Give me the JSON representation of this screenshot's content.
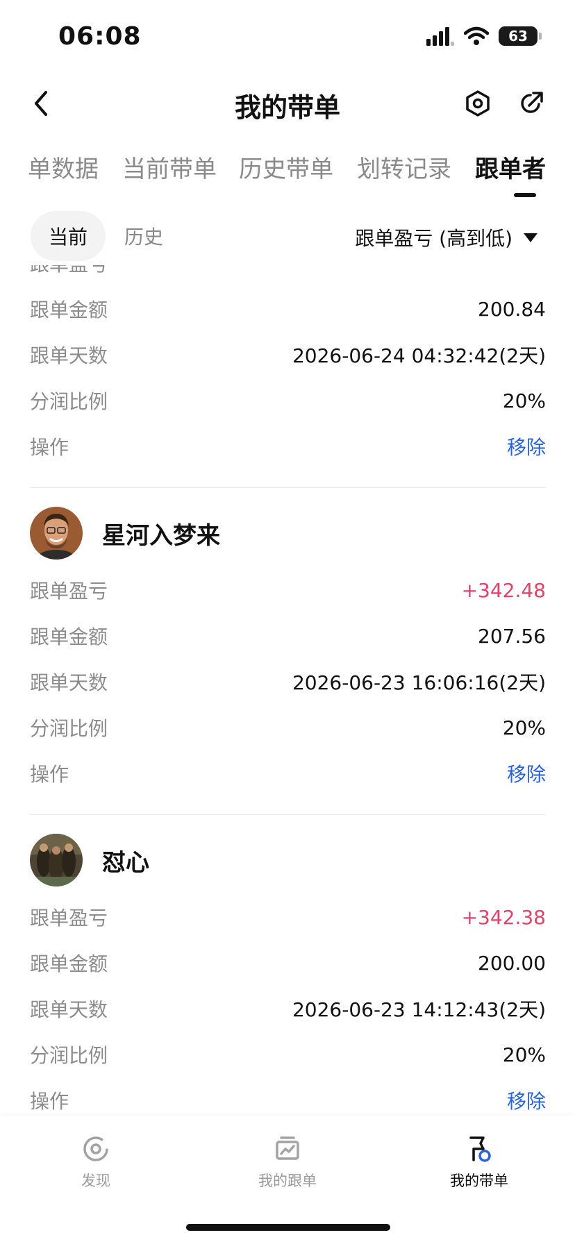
{
  "status_bar": {
    "time": "06:08",
    "battery": "63"
  },
  "header": {
    "title": "我的带单"
  },
  "tabs": [
    {
      "label": "单数据"
    },
    {
      "label": "当前带单"
    },
    {
      "label": "历史带单"
    },
    {
      "label": "划转记录"
    },
    {
      "label": "跟单者",
      "active": true
    }
  ],
  "filter": {
    "chips": [
      {
        "label": "当前",
        "active": true
      },
      {
        "label": "历史",
        "active": false
      }
    ],
    "sort_label": "跟单盈亏 (高到低)"
  },
  "followers": [
    {
      "partial_top": true,
      "rows": [
        {
          "label": "跟单盈亏",
          "value": ""
        },
        {
          "label": "跟单金额",
          "value": "200.84"
        },
        {
          "label": "跟单天数",
          "value": "2026-06-24 04:32:42(2天)"
        },
        {
          "label": "分润比例",
          "value": "20%"
        },
        {
          "label": "操作",
          "value": "移除"
        }
      ]
    },
    {
      "name": "星河入梦来",
      "avatar": "avatar-man",
      "rows": [
        {
          "label": "跟单盈亏",
          "value": "+342.48"
        },
        {
          "label": "跟单金额",
          "value": "207.56"
        },
        {
          "label": "跟单天数",
          "value": "2026-06-23 16:06:16(2天)"
        },
        {
          "label": "分润比例",
          "value": "20%"
        },
        {
          "label": "操作",
          "value": "移除"
        }
      ]
    },
    {
      "name": "怼心",
      "avatar": "avatar-painting",
      "rows": [
        {
          "label": "跟单盈亏",
          "value": "+342.38"
        },
        {
          "label": "跟单金额",
          "value": "200.00"
        },
        {
          "label": "跟单天数",
          "value": "2026-06-23 14:12:43(2天)"
        },
        {
          "label": "分润比例",
          "value": "20%"
        },
        {
          "label": "操作",
          "value": "移除"
        }
      ]
    }
  ],
  "bottom_nav": [
    {
      "label": "发现",
      "icon": "discover-icon"
    },
    {
      "label": "我的跟单",
      "icon": "chart-icon"
    },
    {
      "label": "我的带单",
      "icon": "lead-icon",
      "active": true
    }
  ],
  "colors": {
    "profit": "#e0436a",
    "action": "#2a63d8",
    "accent_blue": "#2a63d8"
  }
}
